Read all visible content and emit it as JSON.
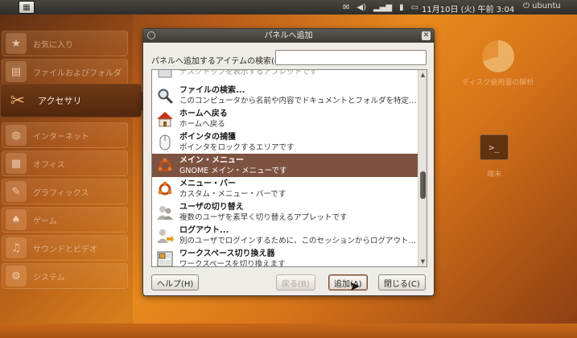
{
  "top_panel": {
    "clock": "11月10日 (火) 午前 3:04",
    "tray_icons": [
      "mail-icon",
      "volume-icon",
      "network-icon",
      "battery-icon",
      "display-icon"
    ],
    "power_label": "ubuntu"
  },
  "categories": [
    {
      "label": "お気に入り",
      "icon": "★",
      "active": false
    },
    {
      "label": "ファイルおよびフォルダ",
      "icon": "▤",
      "active": false
    },
    {
      "label": "アクセサリ",
      "icon": "✂",
      "active": true
    },
    {
      "label": "インターネット",
      "icon": "◍",
      "active": false
    },
    {
      "label": "オフィス",
      "icon": "▦",
      "active": false
    },
    {
      "label": "グラフィックス",
      "icon": "✎",
      "active": false
    },
    {
      "label": "ゲーム",
      "icon": "♠",
      "active": false
    },
    {
      "label": "サウンドとビデオ",
      "icon": "♫",
      "active": false
    },
    {
      "label": "システム",
      "icon": "⚙",
      "active": false
    }
  ],
  "right_apps": [
    {
      "label": "ディスク使用量の解析"
    },
    {
      "label": "端末"
    }
  ],
  "dialog": {
    "title": "パネルへ追加",
    "search_label": "パネルへ追加するアイテムの検索(I):",
    "search_value": "",
    "items": [
      {
        "name": "",
        "desc": "デスクトップを表示するアプレットです",
        "icon": "desk",
        "selected": false
      },
      {
        "name": "ファイルの検索...",
        "desc": "このコンピュータから名前や内容でドキュメントとフォルダを特定…",
        "icon": "search",
        "selected": false
      },
      {
        "name": "ホームへ戻る",
        "desc": "ホームへ戻る",
        "icon": "home",
        "selected": false
      },
      {
        "name": "ポインタの捕獲",
        "desc": "ポインタをロックするエリアです",
        "icon": "mouse",
        "selected": false
      },
      {
        "name": "メイン・メニュー",
        "desc": "GNOME メイン・メニューです",
        "icon": "ubuntu",
        "selected": true
      },
      {
        "name": "メニュー・バー",
        "desc": "カスタム・メニュー・バーです",
        "icon": "ubuntu",
        "selected": false
      },
      {
        "name": "ユーザの切り替え",
        "desc": "複数のユーザを素早く切り替えるアプレットです",
        "icon": "users",
        "selected": false
      },
      {
        "name": "ログアウト...",
        "desc": "別のユーザでログインするために、このセッションからログアウト…",
        "icon": "logout",
        "selected": false
      },
      {
        "name": "ワークスペース切り換え器",
        "desc": "ワークスペースを切り換えます",
        "icon": "workspace",
        "selected": false
      }
    ],
    "buttons": {
      "help": "ヘルプ(H)",
      "back": "戻る(B)",
      "add": "追加(A)",
      "close": "閉じる(C)"
    }
  },
  "colors": {
    "selection": "#7d5240",
    "titlebar": "#4a4843",
    "background_accent": "#e8891e"
  }
}
